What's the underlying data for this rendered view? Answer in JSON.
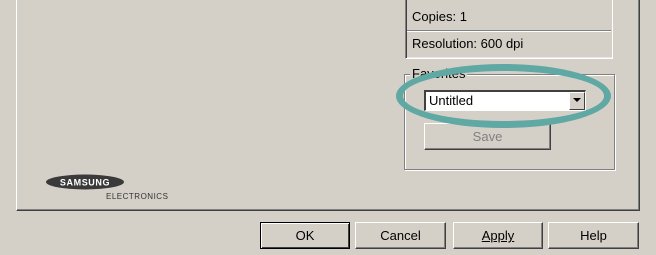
{
  "summary": {
    "copies": "Copies: 1",
    "resolution": "Resolution: 600 dpi"
  },
  "favorites": {
    "legend": "Favorites",
    "selected": "Untitled",
    "save_label": "Save"
  },
  "logo": {
    "brand": "SAMSUNG",
    "subtitle": "ELECTRONICS"
  },
  "buttons": {
    "ok": "OK",
    "cancel": "Cancel",
    "apply": "Apply",
    "help": "Help"
  },
  "icons": {
    "dropdown": "chevron-down-icon"
  },
  "colors": {
    "highlight": "#5fa8a3",
    "dialog_bg": "#d4d0c8"
  }
}
